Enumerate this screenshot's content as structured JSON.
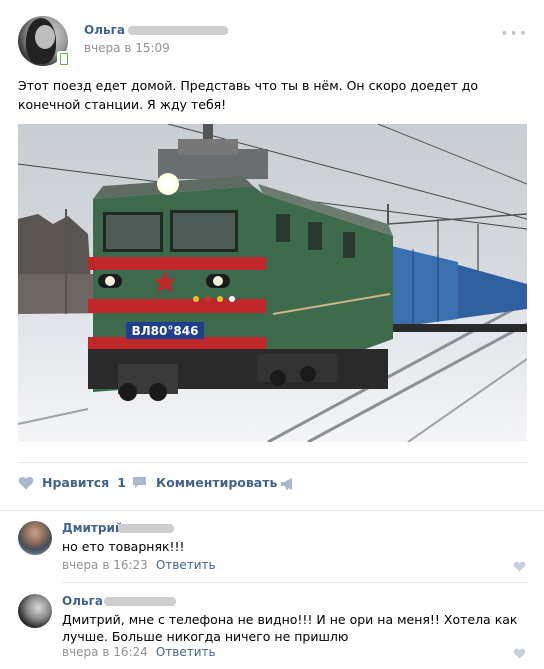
{
  "post": {
    "author": "Ольга",
    "time": "вчера в 15:09",
    "more_icon": "more-dots-icon",
    "text": "Этот поезд едет домой. Представь что ты в нём. Он скоро доедет до конечной станции. Я жду тебя!",
    "photo": {
      "locomotive_plate": "ВЛ80°846"
    }
  },
  "actions": {
    "like_label": "Нравится",
    "like_count": "1",
    "comment_label": "Комментировать",
    "share_icon": "share-megaphone-icon"
  },
  "comments": [
    {
      "author": "Дмитрий",
      "text": "но ето товарняк!!!",
      "time": "вчера в 16:23",
      "reply_label": "Ответить"
    },
    {
      "author": "Ольга",
      "text": "Дмитрий, мне с телефона не видно!!! И не ори на меня!! Хотела как лучше. Больше никогда ничего не пришлю",
      "time": "вчера в 16:24",
      "reply_label": "Ответить"
    }
  ],
  "colors": {
    "link": "#42648b",
    "meta": "#939393",
    "divider": "#e7e8ec",
    "icon": "#c5d0db"
  }
}
